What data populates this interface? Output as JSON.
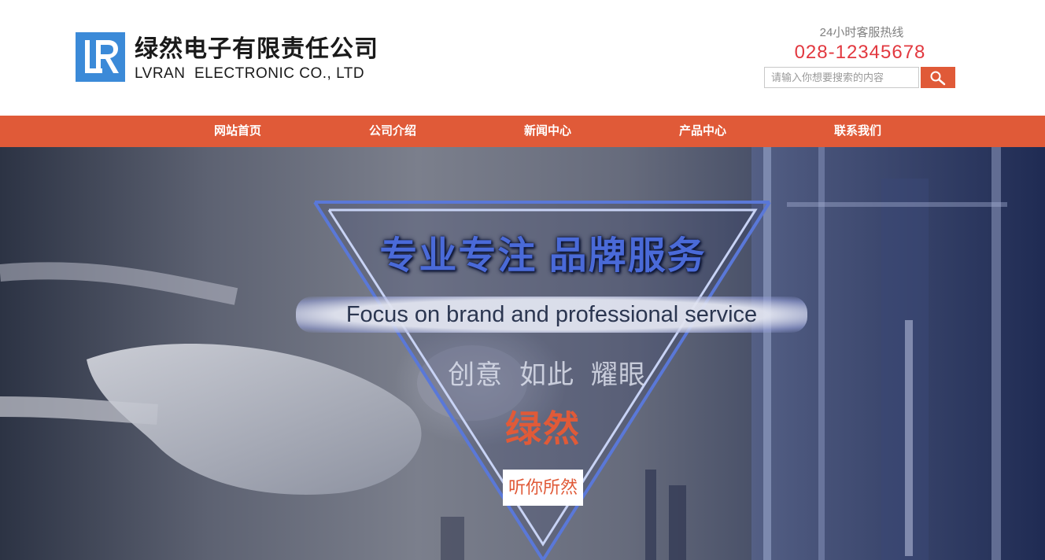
{
  "header": {
    "logo_letters": "LR",
    "company_name_cn": "绿然电子有限责任公司",
    "company_name_en": "LVRAN  ELECTRONIC CO., LTD",
    "hotline_label": "24小时客服热线",
    "hotline_number": "028-12345678",
    "search": {
      "placeholder": "请输入你想要搜索的内容",
      "value": "",
      "button_icon": "search-icon"
    }
  },
  "nav": {
    "items": [
      {
        "label": "网站首页"
      },
      {
        "label": "公司介绍"
      },
      {
        "label": "新闻中心"
      },
      {
        "label": "产品中心"
      },
      {
        "label": "联系我们"
      }
    ]
  },
  "banner": {
    "title_cn": "专业专注 品牌服务",
    "title_en": "Focus on brand and professional service",
    "words": "创意  如此  耀眼",
    "brand": "绿然",
    "tagline": "听你所然"
  },
  "colors": {
    "accent": "#e05a38",
    "hotline": "#e2383f",
    "logo_blue": "#3b8ad8",
    "slogan_blue": "#4a6ad8"
  }
}
